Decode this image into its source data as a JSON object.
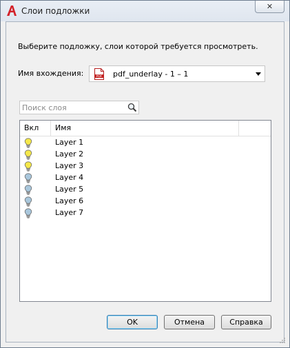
{
  "window": {
    "title": "Слои подложки",
    "close_glyph": "✕"
  },
  "dialog": {
    "prompt": "Выберите подложку, слои которой требуется просмотреть.",
    "inclusion_label": "Имя вхождения:",
    "inclusion_value": "pdf_underlay - 1 – 1",
    "search_placeholder": "Поиск слоя"
  },
  "layers": {
    "columns": [
      "Вкл",
      "Имя"
    ],
    "rows": [
      {
        "name": "Layer 1",
        "on": true
      },
      {
        "name": "Layer 2",
        "on": true
      },
      {
        "name": "Layer 3",
        "on": true
      },
      {
        "name": "Layer 4",
        "on": false
      },
      {
        "name": "Layer 5",
        "on": false
      },
      {
        "name": "Layer 6",
        "on": false
      },
      {
        "name": "Layer 7",
        "on": false
      }
    ]
  },
  "buttons": {
    "ok": "OK",
    "cancel": "Отмена",
    "help": "Справка"
  },
  "colors": {
    "bulb_on": "#f5e84a",
    "bulb_off": "#a9c7dc",
    "app_icon": "#d3222a"
  },
  "icons": {
    "app": "autocad-a-icon",
    "pdf": "pdf-file-icon",
    "search": "magnifier-icon",
    "bulb_on": "light-bulb-on-icon",
    "bulb_off": "light-bulb-off-icon"
  }
}
